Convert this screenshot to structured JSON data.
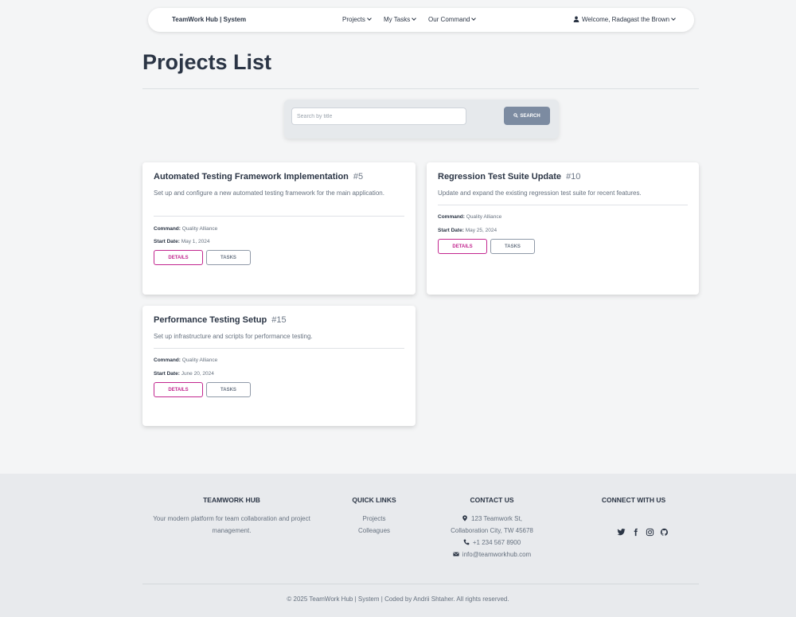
{
  "navbar": {
    "brand": "TeamWork Hub | System",
    "items": [
      "Projects",
      "My Tasks",
      "Our Command"
    ],
    "user": "Welcome, Radagast the Brown"
  },
  "page": {
    "title": "Projects List"
  },
  "search": {
    "placeholder": "Search by title",
    "button_label": "SEARCH"
  },
  "labels": {
    "command": "Command:",
    "start_date": "Start Date:",
    "details": "DETAILS",
    "tasks": "TASKS"
  },
  "projects": [
    {
      "title": "Automated Testing Framework Implementation",
      "number": "#5",
      "description": "Set up and configure a new automated testing framework for the main application.",
      "command": "Quality Alliance",
      "start_date": "May 1, 2024"
    },
    {
      "title": "Regression Test Suite Update",
      "number": "#10",
      "description": "Update and expand the existing regression test suite for recent features.",
      "command": "Quality Alliance",
      "start_date": "May 25, 2024"
    },
    {
      "title": "Performance Testing Setup",
      "number": "#15",
      "description": "Set up infrastructure and scripts for performance testing.",
      "command": "Quality Alliance",
      "start_date": "June 20, 2024"
    }
  ],
  "footer": {
    "about": {
      "heading": "TEAMWORK HUB",
      "text": "Your modern platform for team collaboration and project management."
    },
    "quick_links": {
      "heading": "QUICK LINKS",
      "links": [
        "Projects",
        "Colleagues"
      ]
    },
    "contact": {
      "heading": "CONTACT US",
      "address_line1": "123 Teamwork St,",
      "address_line2": "Collaboration City, TW 45678",
      "phone": "+1 234 567 8900",
      "email": "info@teamworkhub.com"
    },
    "social": {
      "heading": "CONNECT WITH US",
      "icons": [
        "twitter-icon",
        "facebook-icon",
        "instagram-icon",
        "github-icon"
      ]
    },
    "copyright": "© 2025 TeamWork Hub | System | Coded by Andrii Shtaher. All rights reserved."
  },
  "colors": {
    "accent": "#c2268f",
    "search_button": "#7c8ba1",
    "text_dark": "#2b3545",
    "footer_bg": "#e8eaed"
  }
}
